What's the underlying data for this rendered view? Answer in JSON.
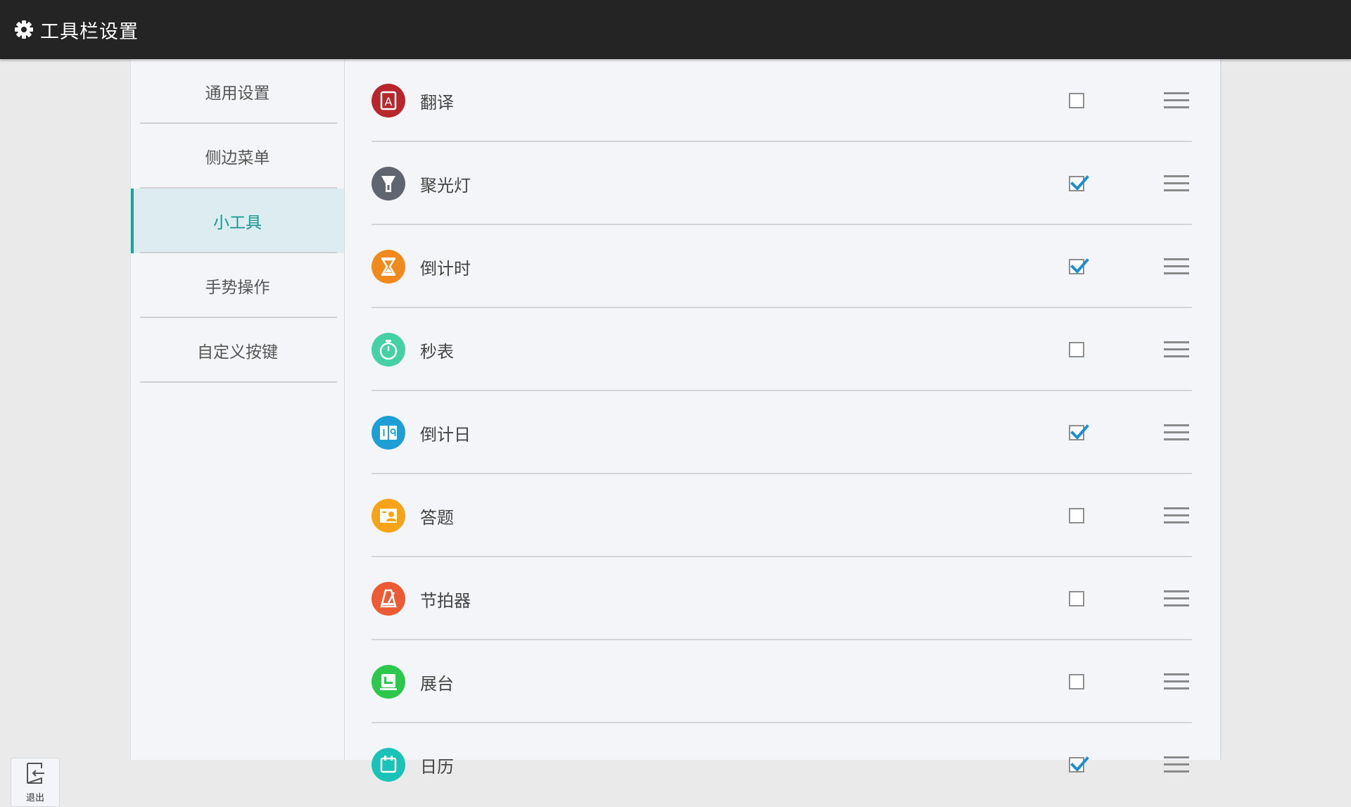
{
  "header": {
    "title": "工具栏设置",
    "icon": "gear-icon"
  },
  "sidebar": {
    "items": [
      {
        "label": "通用设置",
        "active": false
      },
      {
        "label": "侧边菜单",
        "active": false
      },
      {
        "label": "小工具",
        "active": true
      },
      {
        "label": "手势操作",
        "active": false
      },
      {
        "label": "自定义按键",
        "active": false
      }
    ]
  },
  "tools": [
    {
      "label": "翻译",
      "icon": "translate-icon",
      "color": "#b8262b",
      "checked": false
    },
    {
      "label": "聚光灯",
      "icon": "spotlight-icon",
      "color": "#5f6670",
      "checked": true
    },
    {
      "label": "倒计时",
      "icon": "hourglass-icon",
      "color": "#f08a1c",
      "checked": true
    },
    {
      "label": "秒表",
      "icon": "stopwatch-icon",
      "color": "#45d1a4",
      "checked": false
    },
    {
      "label": "倒计日",
      "icon": "calendar-countdown-icon",
      "color": "#1d9fd6",
      "checked": true
    },
    {
      "label": "答题",
      "icon": "quiz-icon",
      "color": "#f6a317",
      "checked": false
    },
    {
      "label": "节拍器",
      "icon": "metronome-icon",
      "color": "#ec5b34",
      "checked": false
    },
    {
      "label": "展台",
      "icon": "document-camera-icon",
      "color": "#2cc84c",
      "checked": false
    },
    {
      "label": "日历",
      "icon": "calendar-icon",
      "color": "#19c3b8",
      "checked": true
    }
  ],
  "exit": {
    "label": "退出",
    "icon": "exit-icon"
  },
  "colors": {
    "accent": "#1aa39a",
    "checkmark": "#1a8fd0",
    "topbar": "#242424"
  }
}
